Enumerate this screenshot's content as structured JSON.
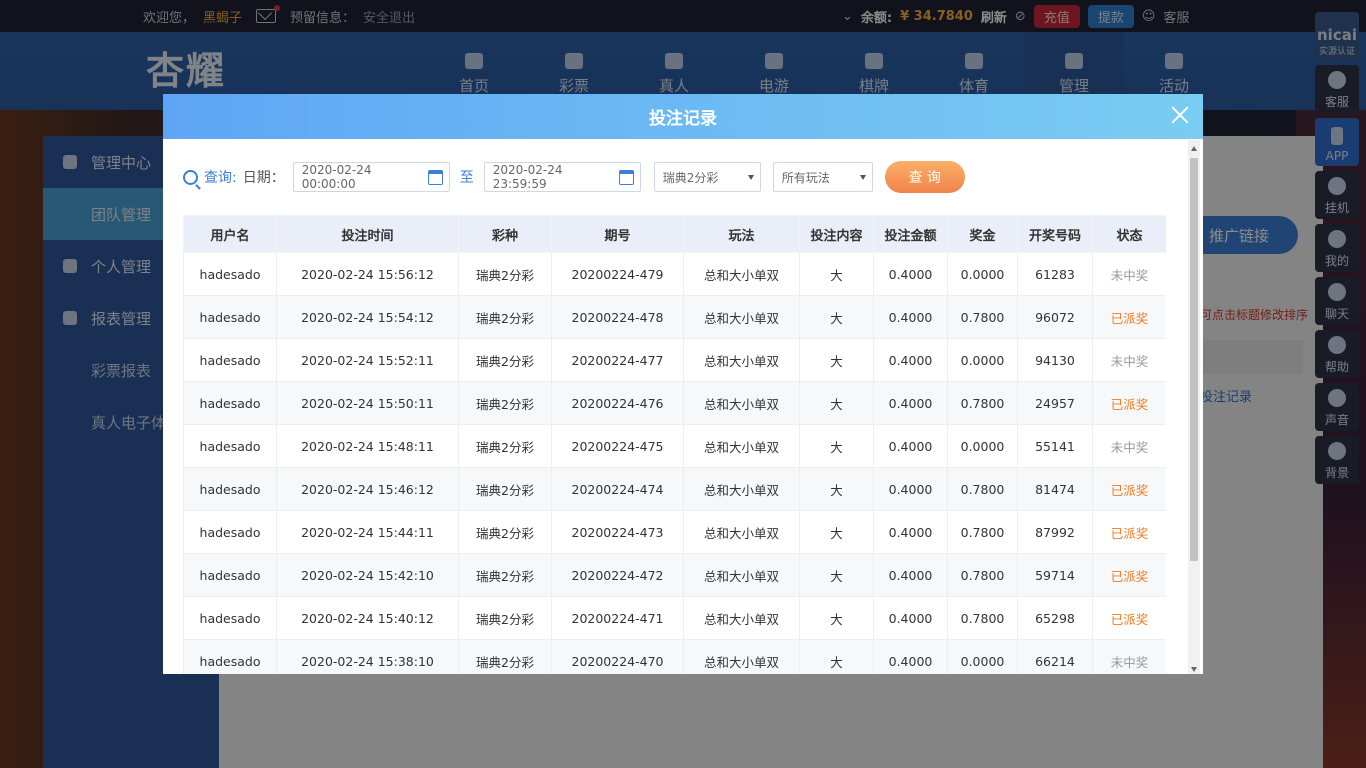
{
  "topbar": {
    "welcome": "欢迎您，",
    "username": "黑蝎子",
    "notice_label": "预留信息：",
    "logout": "安全退出",
    "balance_label": "余额:",
    "balance_value": "¥ 34.7840",
    "refresh": "刷新",
    "recharge": "充值",
    "withdraw": "提款",
    "service": "客服"
  },
  "header": {
    "logo_text": "杏耀",
    "nav": [
      "首页",
      "彩票",
      "真人",
      "电游",
      "棋牌",
      "体育",
      "管理",
      "活动"
    ]
  },
  "sidebar": {
    "items": [
      {
        "label": "管理中心"
      },
      {
        "label": "团队管理"
      },
      {
        "label": "个人管理"
      },
      {
        "label": "报表管理"
      },
      {
        "label": "彩票报表"
      },
      {
        "label": "真人电子体"
      }
    ]
  },
  "background": {
    "promo_button": "推广链接",
    "hint": "可点击标题修改排序",
    "bet_record_link": "投注记录"
  },
  "dock": {
    "brand": "nicai",
    "brand_sub": "实源认证",
    "items": [
      "客服",
      "APP",
      "挂机",
      "我的",
      "聊天",
      "帮助",
      "声音",
      "背景"
    ]
  },
  "modal": {
    "title": "投注记录",
    "filter": {
      "query_label": "查询:",
      "date_label": "日期：",
      "start": "2020-02-24 00:00:00",
      "to": "至",
      "end": "2020-02-24 23:59:59",
      "lottery": "瑞典2分彩",
      "play": "所有玩法",
      "submit": "查 询"
    },
    "columns": [
      "用户名",
      "投注时间",
      "彩种",
      "期号",
      "玩法",
      "投注内容",
      "投注金额",
      "奖金",
      "开奖号码",
      "状态"
    ],
    "rows": [
      [
        "hadesado",
        "2020-02-24 15:56:12",
        "瑞典2分彩",
        "20200224-479",
        "总和大小单双",
        "大",
        "0.4000",
        "0.0000",
        "61283",
        "未中奖"
      ],
      [
        "hadesado",
        "2020-02-24 15:54:12",
        "瑞典2分彩",
        "20200224-478",
        "总和大小单双",
        "大",
        "0.4000",
        "0.7800",
        "96072",
        "已派奖"
      ],
      [
        "hadesado",
        "2020-02-24 15:52:11",
        "瑞典2分彩",
        "20200224-477",
        "总和大小单双",
        "大",
        "0.4000",
        "0.0000",
        "94130",
        "未中奖"
      ],
      [
        "hadesado",
        "2020-02-24 15:50:11",
        "瑞典2分彩",
        "20200224-476",
        "总和大小单双",
        "大",
        "0.4000",
        "0.7800",
        "24957",
        "已派奖"
      ],
      [
        "hadesado",
        "2020-02-24 15:48:11",
        "瑞典2分彩",
        "20200224-475",
        "总和大小单双",
        "大",
        "0.4000",
        "0.0000",
        "55141",
        "未中奖"
      ],
      [
        "hadesado",
        "2020-02-24 15:46:12",
        "瑞典2分彩",
        "20200224-474",
        "总和大小单双",
        "大",
        "0.4000",
        "0.7800",
        "81474",
        "已派奖"
      ],
      [
        "hadesado",
        "2020-02-24 15:44:11",
        "瑞典2分彩",
        "20200224-473",
        "总和大小单双",
        "大",
        "0.4000",
        "0.7800",
        "87992",
        "已派奖"
      ],
      [
        "hadesado",
        "2020-02-24 15:42:10",
        "瑞典2分彩",
        "20200224-472",
        "总和大小单双",
        "大",
        "0.4000",
        "0.7800",
        "59714",
        "已派奖"
      ],
      [
        "hadesado",
        "2020-02-24 15:40:12",
        "瑞典2分彩",
        "20200224-471",
        "总和大小单双",
        "大",
        "0.4000",
        "0.7800",
        "65298",
        "已派奖"
      ],
      [
        "hadesado",
        "2020-02-24 15:38:10",
        "瑞典2分彩",
        "20200224-470",
        "总和大小单双",
        "大",
        "0.4000",
        "0.0000",
        "66214",
        "未中奖"
      ]
    ]
  }
}
